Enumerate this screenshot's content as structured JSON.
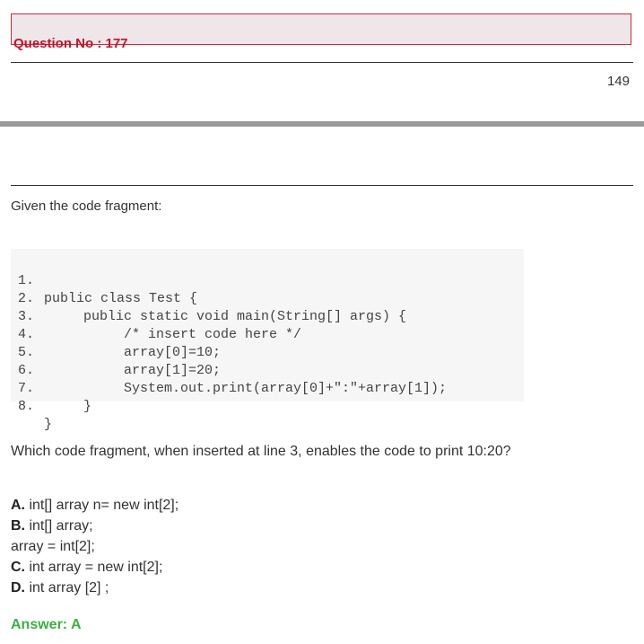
{
  "question": {
    "title": "Question No : 177",
    "page_number": "149"
  },
  "intro": "Given the code fragment:",
  "code": {
    "lines": [
      {
        "num": "1.",
        "text": "public class Test {"
      },
      {
        "num": "2.",
        "text": "public static void main(String[] args) {"
      },
      {
        "num": "3.",
        "text": "/* insert code here */"
      },
      {
        "num": "4.",
        "text": "array[0]=10;"
      },
      {
        "num": "5.",
        "text": "array[1]=20;"
      },
      {
        "num": "6.",
        "text": "System.out.print(array[0]+\":\"+array[1]);"
      },
      {
        "num": "7.",
        "text": "}"
      },
      {
        "num": "8.",
        "text": "}"
      }
    ]
  },
  "prompt": "Which code fragment, when inserted at line 3, enables the code to print 10:20?",
  "options": [
    {
      "letter": "A.",
      "text": " int[] array n= new int[2];"
    },
    {
      "letter": "B.",
      "text": " int[] array;"
    },
    {
      "letter": "",
      "text": "array = int[2];"
    },
    {
      "letter": "C.",
      "text": " int array = new int[2];"
    },
    {
      "letter": "D.",
      "text": " int array [2] ;"
    }
  ],
  "answer": "Answer: A"
}
